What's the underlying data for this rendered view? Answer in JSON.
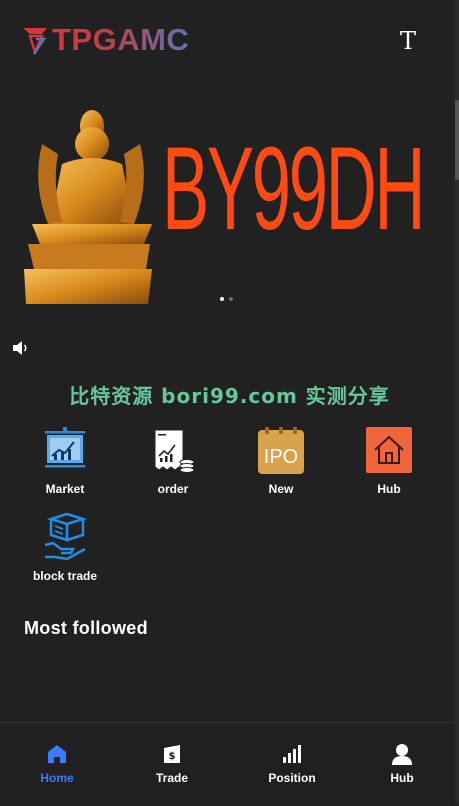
{
  "header": {
    "brand": "TPGAMC",
    "lang_glyph": "T"
  },
  "banner": {
    "text": "BY99DH",
    "slides": 2,
    "active_slide": 0
  },
  "promo_text": "比特资源 bori99.com 实测分享",
  "quick_menu": [
    {
      "label": "Market",
      "icon": "market-chart-icon"
    },
    {
      "label": "order",
      "icon": "order-document-icon"
    },
    {
      "label": "New",
      "icon": "ipo-icon"
    },
    {
      "label": "Hub",
      "icon": "home-hub-icon"
    },
    {
      "label": "block trade",
      "icon": "block-trade-icon"
    }
  ],
  "section": {
    "title": "Most followed"
  },
  "bottom_nav": [
    {
      "label": "Home",
      "icon": "home-icon",
      "active": true
    },
    {
      "label": "Trade",
      "icon": "trade-wallet-icon",
      "active": false
    },
    {
      "label": "Position",
      "icon": "position-bars-icon",
      "active": false
    },
    {
      "label": "Hub",
      "icon": "user-icon",
      "active": false
    }
  ],
  "colors": {
    "background": "#212121",
    "accent": "#3a7bff",
    "promo": "#66c89a",
    "banner_text": "#ff4a12"
  }
}
